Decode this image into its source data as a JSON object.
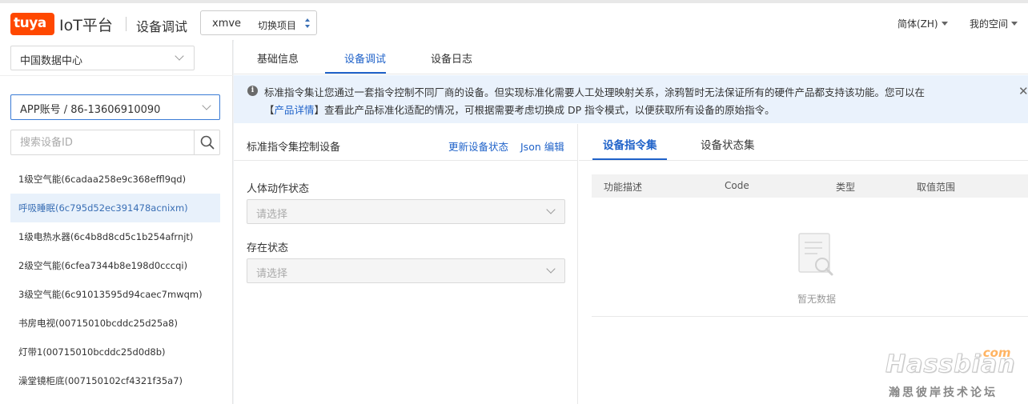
{
  "header": {
    "logo_text": "tuya",
    "platform": "IoT平台",
    "page_title": "设备调试",
    "project": {
      "name": "xmve",
      "switch_label": "切换项目"
    },
    "language": "简体(ZH)",
    "my_space": "我的空间"
  },
  "sidebar": {
    "data_center": "中国数据中心",
    "account": "APP账号 / 86-13606910090",
    "search_placeholder": "搜索设备ID",
    "devices": [
      {
        "label": "1级空气能(6cadaa258e9c368effl9qd)"
      },
      {
        "label": "呼吸睡眠(6c795d52ec391478acnixm)"
      },
      {
        "label": "1级电热水器(6c4b8d8cd5c1b254afrnjt)"
      },
      {
        "label": "2级空气能(6cfea7344b8e198d0cccqi)"
      },
      {
        "label": "3级空气能(6c91013595d94caec7mwqm)"
      },
      {
        "label": "书房电视(00715010bcddc25d25a8)"
      },
      {
        "label": "灯带1(00715010bcddc25d0d8b)"
      },
      {
        "label": "澡堂镜柜底(007150102cf4321f35a7)"
      }
    ]
  },
  "main": {
    "tabs": [
      {
        "label": "基础信息"
      },
      {
        "label": "设备调试"
      },
      {
        "label": "设备日志"
      }
    ],
    "notice": {
      "line1": "标准指令集让您通过一套指令控制不同厂商的设备。但实现标准化需要人工处理映射关系，涂鸦暂时无法保证所有的硬件产品都支持该功能。您可以在",
      "link_open": "【",
      "link": "产品详情",
      "line2": "】查看此产品标准化适配的情况，可根据需要考虑切换成 DP 指令模式，以便获取所有设备的原始指令。"
    },
    "left_panel": {
      "title": "标准指令集控制设备",
      "refresh_label": "更新设备状态",
      "json_label": "Json 编辑",
      "fields": [
        {
          "label": "人体动作状态",
          "placeholder": "请选择"
        },
        {
          "label": "存在状态",
          "placeholder": "请选择"
        }
      ]
    },
    "right_panel": {
      "tabs": [
        {
          "label": "设备指令集"
        },
        {
          "label": "设备状态集"
        }
      ],
      "columns": [
        "功能描述",
        "Code",
        "类型",
        "取值范围"
      ],
      "empty_text": "暂无数据"
    }
  },
  "watermark": {
    "com": ".com",
    "brand": "Hassbian",
    "subtitle": "瀚思彼岸技术论坛"
  },
  "colors": {
    "accent": "#1f62c9",
    "brand_orange": "#ff4800",
    "notice_bg": "#eaf2fc",
    "active_row_bg": "#e8f1fb"
  }
}
